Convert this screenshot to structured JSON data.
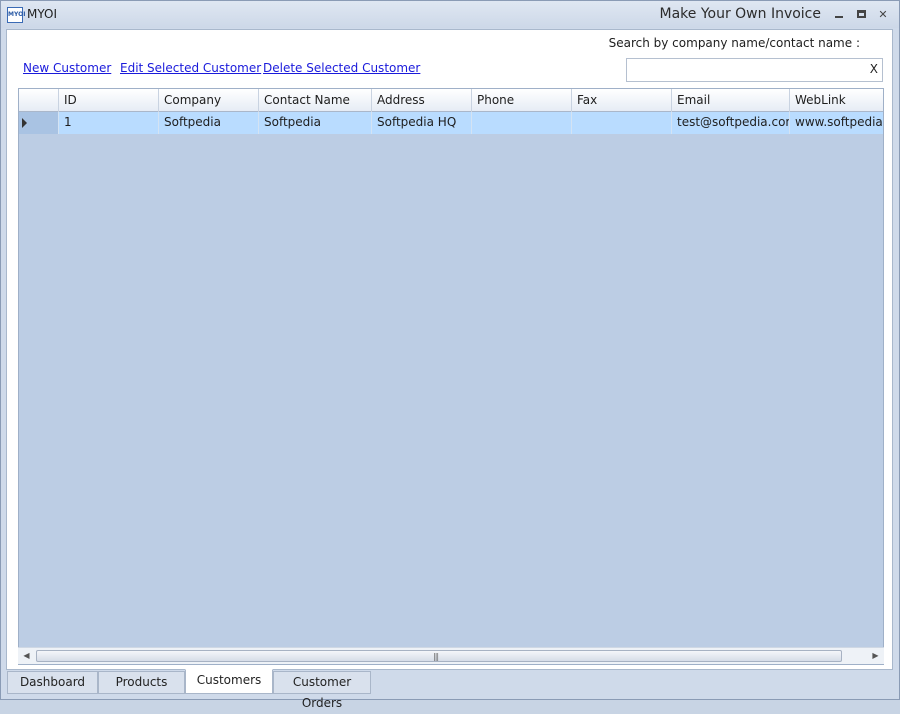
{
  "app": {
    "name": "MYOI",
    "icon_text": "MYOI",
    "window_title": "Make Your Own Invoice",
    "controls": {
      "close": "✕"
    }
  },
  "search": {
    "label": "Search by company name/contact name   :",
    "value": "",
    "placeholder": "",
    "clear": "X"
  },
  "actions": {
    "new": "New Customer",
    "edit": "Edit Selected Customer",
    "delete": "Delete Selected Customer"
  },
  "grid": {
    "columns": [
      "ID",
      "Company",
      "Contact Name",
      "Address",
      "Phone",
      "Fax",
      "Email",
      "WebLink"
    ],
    "rows": [
      [
        "1",
        "Softpedia",
        "Softpedia",
        "Softpedia HQ",
        "",
        "",
        "test@softpedia.com",
        "www.softpedia.com"
      ]
    ],
    "selected_row": 0
  },
  "scrollbar": {
    "grip": "|||"
  },
  "tabs": [
    {
      "label": "Dashboard",
      "active": false
    },
    {
      "label": "Products",
      "active": false
    },
    {
      "label": "Customers",
      "active": true
    },
    {
      "label": "Customer Orders",
      "active": false
    }
  ],
  "colors": {
    "grid_background": "#bccde4",
    "selected_row": "#b9dcff",
    "link": "#1a1adb"
  }
}
